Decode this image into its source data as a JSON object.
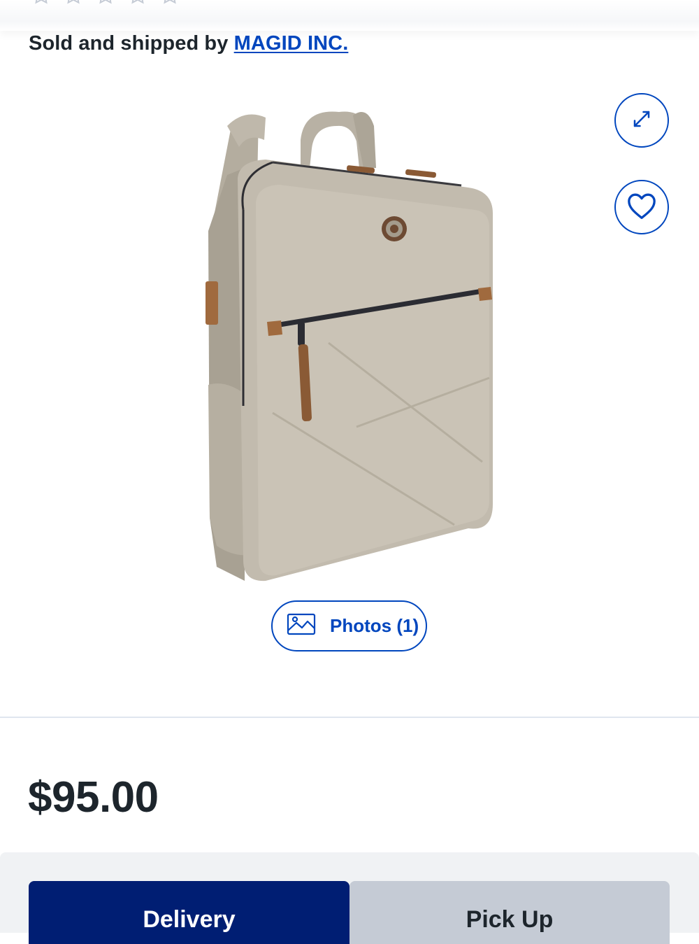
{
  "rating": {
    "stars_filled": 0,
    "stars_total": 5
  },
  "seller": {
    "prefix": "Sold and shipped by ",
    "name": "MAGID INC."
  },
  "gallery": {
    "image_alt": "Taupe laptop backpack with tan leather accents",
    "expand_icon": "expand-icon",
    "favorite_icon": "heart-icon",
    "photos_label": "Photos (1)",
    "photos_icon": "image-icon"
  },
  "price": {
    "value": "$95.00"
  },
  "fulfillment": {
    "tabs": [
      {
        "label": "Delivery",
        "selected": true
      },
      {
        "label": "Pick Up",
        "selected": false
      }
    ]
  },
  "colors": {
    "link_blue": "#0046be",
    "selected_tab": "#001e73",
    "unselected_tab": "#c5cbd5"
  }
}
